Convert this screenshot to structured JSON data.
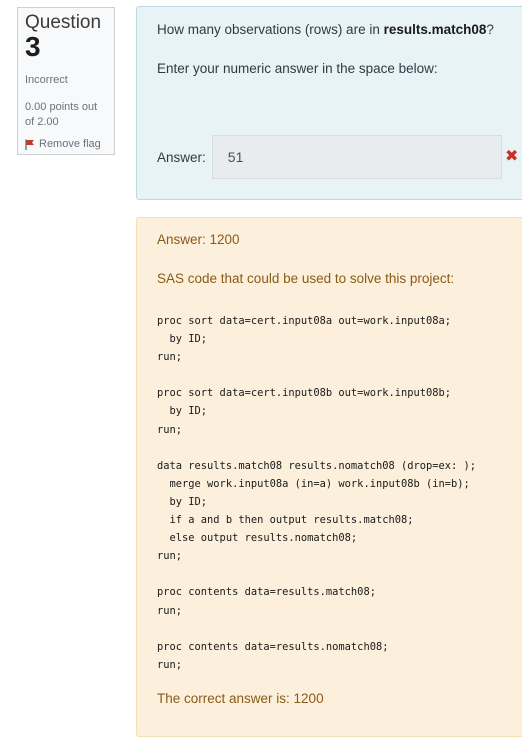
{
  "info": {
    "question_word": "Question",
    "question_number": "3",
    "state": "Incorrect",
    "grade": "0.00 points out of 2.00",
    "flag_label": "Remove flag",
    "flag_color": "#c0392b"
  },
  "question": {
    "text_before": "How many observations (rows) are in ",
    "text_bold": "results.match08",
    "text_after": "?",
    "instruction": "Enter your numeric answer in the space below:",
    "answer_label": "Answer:",
    "answer_value": "51",
    "incorrect_icon": "close-icon"
  },
  "feedback": {
    "answer_line": "Answer: 1200",
    "sas_intro": "SAS code that could be used to solve this project:",
    "code": "proc sort data=cert.input08a out=work.input08a;\n  by ID;\nrun;\n\nproc sort data=cert.input08b out=work.input08b;\n  by ID;\nrun;\n\ndata results.match08 results.nomatch08 (drop=ex: );\n  merge work.input08a (in=a) work.input08b (in=b);\n  by ID;\n  if a and b then output results.match08;\n  else output results.nomatch08;\nrun;\n\nproc contents data=results.match08;\nrun;\n\nproc contents data=results.nomatch08;\nrun;",
    "correct_answer": "The correct answer is: 1200"
  },
  "colors": {
    "question_bg": "#e7f3f5",
    "feedback_bg": "#fcefdc",
    "feedback_text": "#8a5b18",
    "incorrect": "#ca3120"
  }
}
